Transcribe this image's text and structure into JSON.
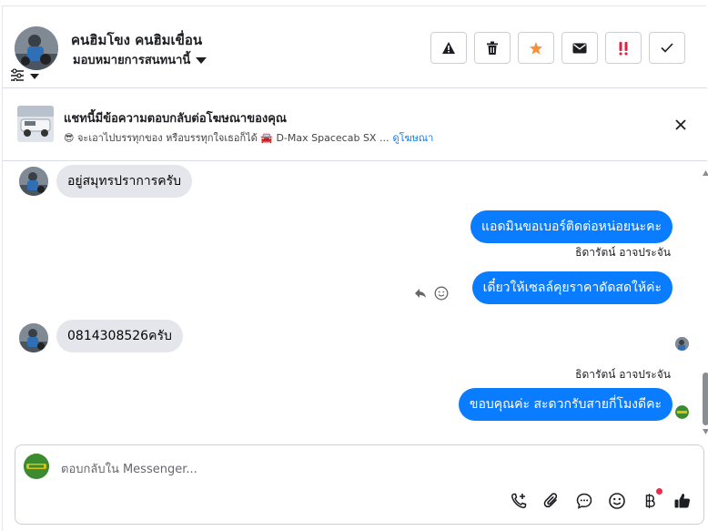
{
  "header": {
    "name": "คนฮิมโขง คนฮิมเขื่อน",
    "assign_label": "มอบหมายการสนทนานี้",
    "actions": [
      {
        "icon": "warning-icon",
        "color": "#1c1e21"
      },
      {
        "icon": "trash-icon",
        "color": "#1c1e21"
      },
      {
        "icon": "star-icon",
        "color": "#f7923b"
      },
      {
        "icon": "mail-icon",
        "color": "#1c1e21"
      },
      {
        "icon": "double-exclamation-icon",
        "color": "#e41e3f"
      },
      {
        "icon": "check-icon",
        "color": "#1c1e21"
      }
    ]
  },
  "ad_notice": {
    "title": "แชทนี้มีข้อความตอบกลับต่อโฆษณาของคุณ",
    "subtitle": "😎 จะเอาไปบรรทุกของ หรือบรรทุกใจเธอก็ได้ 🚘 D-Max Spacecab SX ...",
    "link": "ดูโฆษณา"
  },
  "messages": [
    {
      "direction": "in",
      "text": "อยู่สมุทรปราการครับ"
    },
    {
      "direction": "out",
      "text": "แอดมินขอเบอร์ติดต่อหน่อยนะคะ"
    },
    {
      "direction": "out",
      "sender": "ธิดารัตน์ อาจประจัน",
      "text": "เดี๋ยวให้เซลล์คุยราคาดัดสดให้ค่ะ"
    },
    {
      "direction": "in",
      "text": "0814308526ครับ"
    },
    {
      "direction": "out",
      "sender": "ธิดารัตน์ อาจประจัน",
      "text": "ขอบคุณค่ะ สะดวกรับสายกี่โมงดีคะ"
    }
  ],
  "composer": {
    "placeholder": "ตอบกลับใน Messenger..."
  },
  "colors": {
    "accent": "#0a7cff",
    "incoming_bubble": "#e4e6eb"
  }
}
